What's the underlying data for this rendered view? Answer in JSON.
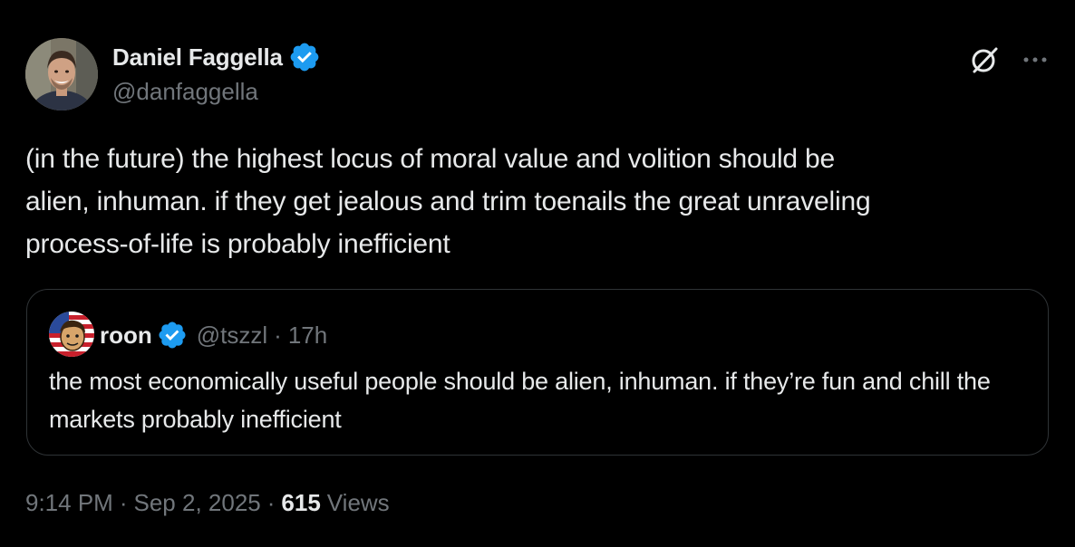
{
  "colors": {
    "background": "#000000",
    "primary_text": "#e7e9ea",
    "secondary_text": "#71767b",
    "border": "#2f3336",
    "verified_blue": "#1d9bf0"
  },
  "author": {
    "name": "Daniel Faggella",
    "handle": "@danfaggella",
    "avatar_icon": "user-photo-avatar",
    "verified_icon": "verified-badge-icon"
  },
  "actions": {
    "grok_icon": "grok-icon",
    "more_icon": "more-options-icon"
  },
  "tweet": {
    "text": "(in the future) the highest locus of moral value and volition should be\nalien, inhuman. if they get jealous and trim toenails the great unraveling\nprocess-of-life is probably inefficient"
  },
  "quote": {
    "name": "roon",
    "handle": "@tszzl",
    "separator": "·",
    "time": "17h",
    "text": "the most economically useful people should be alien, inhuman. if they’re fun and chill the markets probably inefficient",
    "avatar_icon": "cartoon-avatar",
    "verified_icon": "verified-badge-icon"
  },
  "meta": {
    "time": "9:14 PM",
    "separator": "·",
    "date": "Sep 2, 2025",
    "views_count": "615",
    "views_label": "Views"
  }
}
